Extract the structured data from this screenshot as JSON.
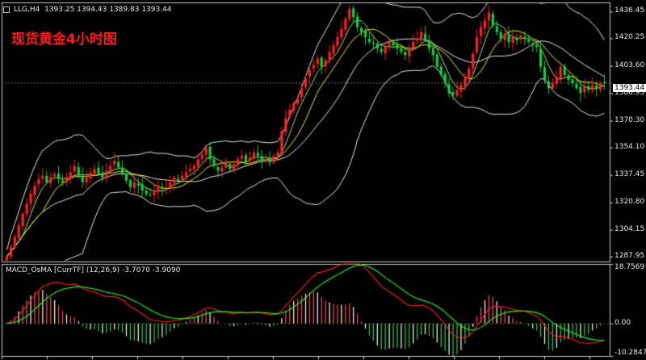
{
  "header": {
    "symbol_line": "LLG,H4  1393.25 1394.43 1389.83 1393.44",
    "title_cn": "现货黄金4小时图"
  },
  "macd": {
    "label": "MACD_OsMA [CurrTF] (12,26,9) -3.7070 -3.9090"
  },
  "colors": {
    "background": "#000000",
    "bull_candle": "#ff2020",
    "bear_candle": "#10d040",
    "bollinger": "#ffffff",
    "fast_ma": "#f2f200",
    "macd_line": "#ff2020",
    "signal_line": "#20ff20",
    "hist_pos": "#ff5050",
    "hist_neg": "#2fd04f",
    "hist_mid": "#ffffff"
  },
  "chart_data": [
    {
      "type": "candlestick",
      "name": "price",
      "ylim": [
        1285,
        1442
      ],
      "y_ticks": [
        1436.45,
        1420.25,
        1403.6,
        1386.95,
        1370.3,
        1354.1,
        1337.45,
        1320.8,
        1304.15,
        1287.95
      ],
      "current_price": "1393.44",
      "indicators": [
        "Bollinger Bands",
        "Moving Average"
      ],
      "close": [
        1288,
        1294,
        1300,
        1307,
        1314,
        1320,
        1326,
        1331,
        1335,
        1337,
        1333,
        1336,
        1338,
        1335,
        1333,
        1336,
        1339,
        1343,
        1337,
        1333,
        1336,
        1339,
        1341,
        1338,
        1336,
        1340,
        1343,
        1346,
        1342,
        1338,
        1334,
        1330,
        1333,
        1331,
        1328,
        1326,
        1325,
        1328,
        1331,
        1329,
        1330,
        1333,
        1336,
        1334,
        1337,
        1339,
        1341,
        1343,
        1347,
        1350,
        1354,
        1347,
        1343,
        1340,
        1342,
        1345,
        1341,
        1344,
        1347,
        1349,
        1345,
        1348,
        1351,
        1349,
        1346,
        1347,
        1345,
        1349,
        1351,
        1364,
        1372,
        1377,
        1381,
        1384,
        1390,
        1396,
        1401,
        1404,
        1408,
        1403,
        1407,
        1412,
        1416,
        1421,
        1426,
        1432,
        1438,
        1433,
        1427,
        1424,
        1421,
        1418,
        1417,
        1414,
        1412,
        1415,
        1418,
        1416,
        1414,
        1412,
        1410,
        1413,
        1418,
        1420,
        1424,
        1419,
        1414,
        1410,
        1403,
        1398,
        1393,
        1387,
        1386,
        1389,
        1392,
        1397,
        1402,
        1411,
        1421,
        1427,
        1431,
        1436,
        1428,
        1424,
        1420,
        1423,
        1418,
        1421,
        1419,
        1422,
        1420,
        1418,
        1416,
        1415,
        1403,
        1395,
        1390,
        1393,
        1397,
        1403,
        1398,
        1395,
        1393,
        1390,
        1387,
        1391,
        1389,
        1392,
        1390,
        1393,
        1393
      ]
    },
    {
      "type": "macd",
      "name": "MACD_OsMA",
      "ylim": [
        -10.2847,
        18.7569
      ],
      "y_ticks": [
        18.7569,
        0.0,
        -10.2847
      ],
      "params": [
        12,
        26,
        9
      ],
      "macd": -3.707,
      "signal": -3.909
    }
  ]
}
